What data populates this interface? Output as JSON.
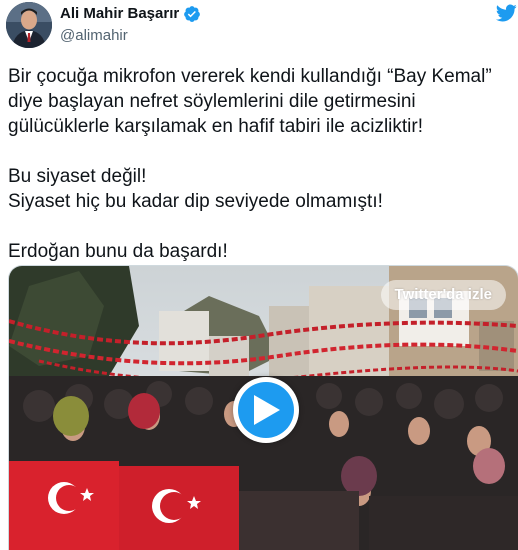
{
  "author": {
    "display_name": "Ali Mahir Başarır",
    "handle": "@alimahir",
    "verified": true
  },
  "tweet": {
    "paragraph_1": [
      "Bir çocuğa mikrofon vererek kendi kullandığı “Bay Kemal”",
      "diye başlayan nefret söylemlerini dile getirmesini",
      "gülücüklerle karşılamak en hafif tabiri ile acizliktir!"
    ],
    "paragraph_2": [
      "Bu siyaset değil!",
      "Siyaset hiç bu kadar dip seviyede olmamıştı!"
    ],
    "paragraph_3": [
      "Erdoğan bunu da başardı!"
    ]
  },
  "media": {
    "watch_on_twitter": "Twitter'da izle",
    "play_icon": "play-icon"
  },
  "colors": {
    "accent": "#1d9bf0",
    "text": "#0f1419",
    "secondary": "#536471"
  }
}
